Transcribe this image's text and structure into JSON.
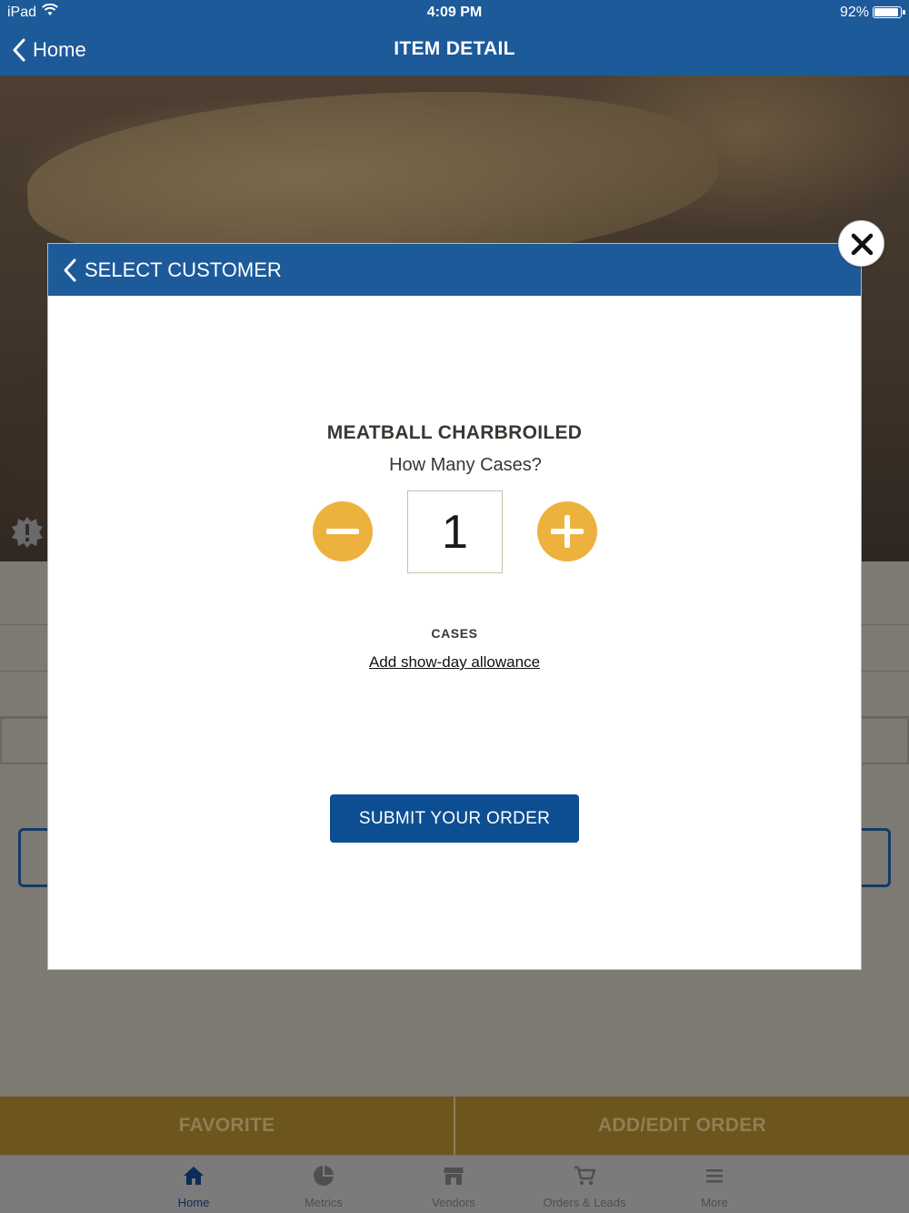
{
  "status_bar": {
    "device": "iPad",
    "time": "4:09 PM",
    "battery": "92%",
    "battery_level": 0.92
  },
  "nav": {
    "back_label": "Home",
    "title": "ITEM DETAIL"
  },
  "modal": {
    "header_title": "SELECT CUSTOMER",
    "product_name": "MEATBALL CHARBROILED",
    "quantity_prompt": "How Many Cases?",
    "quantity_value": "1",
    "unit_label": "CASES",
    "allowance_link": "Add show-day allowance",
    "submit_label": "SUBMIT YOUR ORDER"
  },
  "action_bar": {
    "favorite_label": "FAVORITE",
    "order_label": "ADD/EDIT ORDER"
  },
  "tab_bar": {
    "tabs": [
      {
        "label": "Home",
        "icon": "home-icon",
        "active": true
      },
      {
        "label": "Metrics",
        "icon": "pie-chart-icon",
        "active": false
      },
      {
        "label": "Vendors",
        "icon": "store-icon",
        "active": false
      },
      {
        "label": "Orders & Leads",
        "icon": "cart-icon",
        "active": false
      },
      {
        "label": "More",
        "icon": "menu-icon",
        "active": false
      }
    ]
  },
  "colors": {
    "brand_blue": "#1d5a9a",
    "submit_blue": "#0d4e92",
    "stepper_yellow": "#edb23d",
    "action_bar_gold": "#6d561d"
  }
}
